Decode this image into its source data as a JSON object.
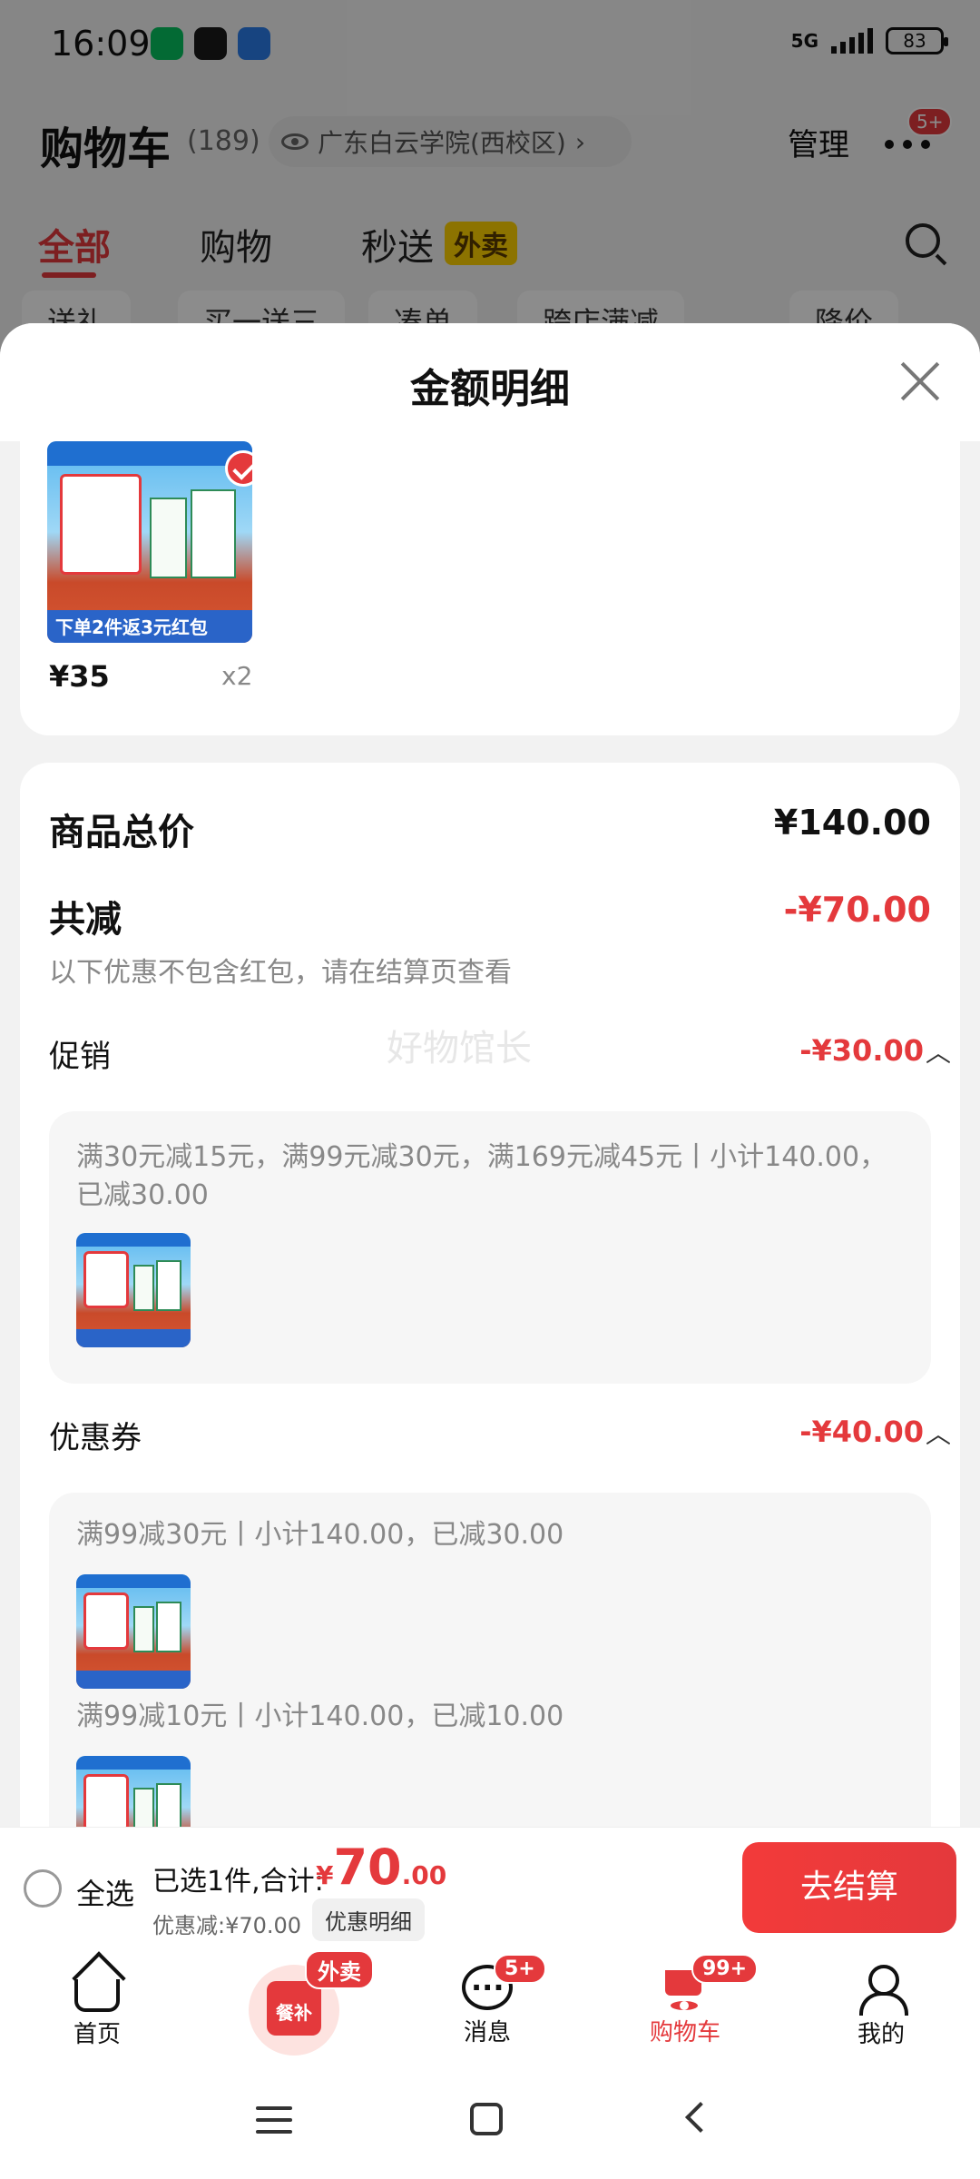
{
  "status_bar": {
    "time": "16:09",
    "network": "5G",
    "battery": "83"
  },
  "cart_header": {
    "title": "购物车",
    "count": "(189)",
    "location": "广东白云学院(西校区)",
    "location_chevron": "›",
    "manage": "管理",
    "more_badge": "5+"
  },
  "tabs": {
    "all": "全部",
    "shopping": "购物",
    "express": "秒送",
    "takeaway_tag": "外卖"
  },
  "filters": [
    "送礼",
    "买一送三",
    "凑单",
    "跨店满减",
    "降价"
  ],
  "sheet": {
    "title": "金额明细",
    "product": {
      "price": "¥35",
      "qty": "x2",
      "bottom_text": "下单2件返3元红包"
    },
    "total_label": "商品总价",
    "total_value": "¥140.00",
    "reduce_label": "共减",
    "reduce_value": "-¥70.00",
    "note": "以下优惠不包含红包，请在结算页查看",
    "watermark": "好物馆长",
    "promo": {
      "label": "促销",
      "value": "-¥30.00",
      "chevron": "︿",
      "detail": "满30元减15元，满99元减30元，满169元减45元丨小计140.00，已减30.00"
    },
    "coupon": {
      "label": "优惠券",
      "value": "-¥40.00",
      "chevron": "︿",
      "detail1": "满99减30元丨小计140.00，已减30.00",
      "detail2": "满99减10元丨小计140.00，已减10.00"
    }
  },
  "checkout": {
    "select_all": "全选",
    "selected_summary": "已选1件,合计:",
    "total_yen": "¥",
    "total_int": "70",
    "total_dec": ".00",
    "discount": "优惠减:¥70.00",
    "discount_detail_button": "优惠明细",
    "checkout_button": "去结算"
  },
  "bottom_nav": {
    "home": "首页",
    "canbu": "餐补",
    "canbu_badge": "外卖",
    "messages": "消息",
    "messages_badge": "5+",
    "cart": "购物车",
    "cart_badge": "99+",
    "me": "我的"
  },
  "colors": {
    "accent": "#e4393c",
    "takeaway_tag": "#ffd200"
  }
}
